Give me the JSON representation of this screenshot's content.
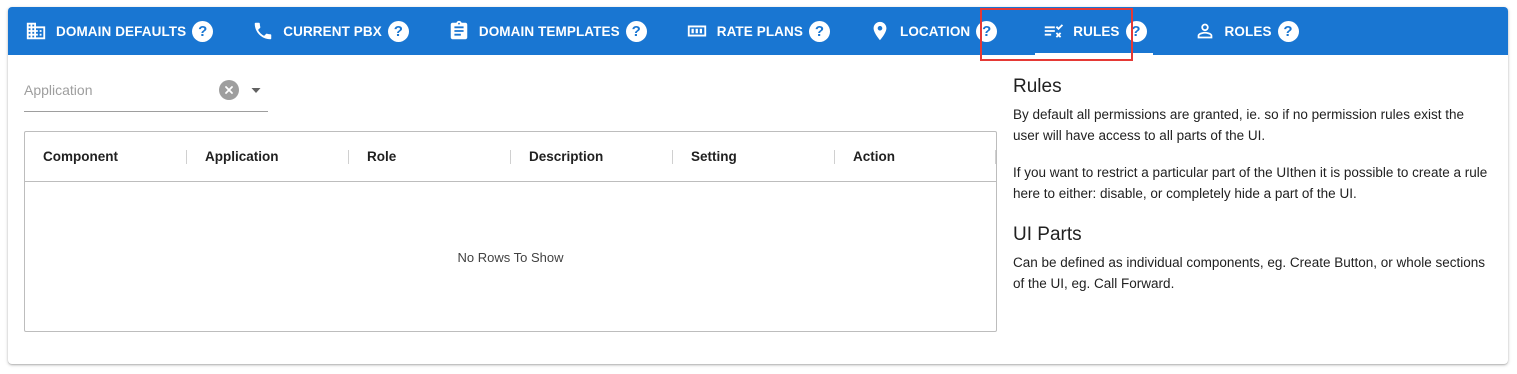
{
  "tabs": [
    {
      "label": "DOMAIN DEFAULTS",
      "icon": "building-icon"
    },
    {
      "label": "CURRENT PBX",
      "icon": "phone-icon"
    },
    {
      "label": "DOMAIN TEMPLATES",
      "icon": "clipboard-icon"
    },
    {
      "label": "RATE PLANS",
      "icon": "counter-icon"
    },
    {
      "label": "LOCATION",
      "icon": "location-pin-icon"
    },
    {
      "label": "RULES",
      "icon": "rules-list-icon",
      "active": true
    },
    {
      "label": "ROLES",
      "icon": "person-icon"
    }
  ],
  "help_glyph": "?",
  "filter": {
    "placeholder": "Application",
    "value": ""
  },
  "grid": {
    "columns": [
      "Component",
      "Application",
      "Role",
      "Description",
      "Setting",
      "Action"
    ],
    "rows": [],
    "empty_text": "No Rows To Show"
  },
  "help": {
    "rules_title": "Rules",
    "rules_p1": "By default all permissions are granted, ie. so if no permission rules exist the user will have access to all parts of the UI.",
    "rules_p2": "If you want to restrict a particular part of the UIthen it is possible to create a rule here to either: disable, or completely hide a part of the UI.",
    "ui_parts_title": "UI Parts",
    "ui_parts_p1": "Can be defined as individual components, eg. Create Button, or whole sections of the UI, eg. Call Forward."
  },
  "colors": {
    "primary": "#1976d2",
    "highlight": "#e53935"
  }
}
